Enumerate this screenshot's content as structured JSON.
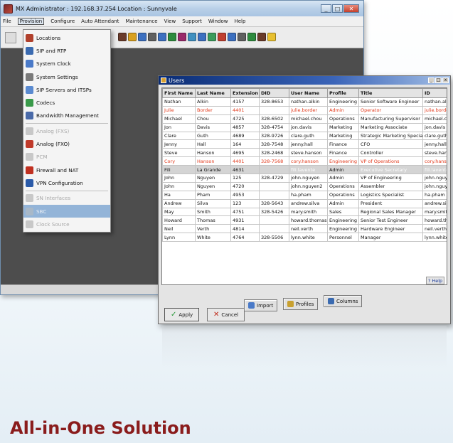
{
  "main_window": {
    "title": "MX Administrator : 192.168.37.254  Location : Sunnyvale",
    "controls": [
      "_",
      "□",
      "✕"
    ]
  },
  "menubar": [
    "File",
    "Provision",
    "Configure",
    "Auto Attendant",
    "Maintenance",
    "View",
    "Support",
    "Window",
    "Help"
  ],
  "provision_menu": [
    {
      "label": "Locations",
      "icon": "location-icon",
      "color": "#b0402c",
      "state": "normal"
    },
    {
      "label": "SIP and RTP",
      "icon": "sip-icon",
      "color": "#3a6ab0",
      "state": "normal"
    },
    {
      "label": "System Clock",
      "icon": "clock-icon",
      "color": "#4a7ac8",
      "state": "normal"
    },
    {
      "label": "System Settings",
      "icon": "wrench-icon",
      "color": "#7a7a7a",
      "state": "normal"
    },
    {
      "label": "SIP Servers and ITSPs",
      "icon": "server-icon",
      "color": "#5a8ad0",
      "state": "normal"
    },
    {
      "label": "Codecs",
      "icon": "codec-icon",
      "color": "#3a9a4a",
      "state": "normal"
    },
    {
      "label": "Bandwidth Management",
      "icon": "bandwidth-icon",
      "color": "#4a6aa8",
      "state": "normal"
    },
    {
      "label": "Analog (FXS)",
      "icon": "fxs-icon",
      "color": "#c8c8c8",
      "state": "disabled"
    },
    {
      "label": "Analog (FXO)",
      "icon": "fxo-icon",
      "color": "#c03a2a",
      "state": "normal"
    },
    {
      "label": "PCM",
      "icon": "pcm-icon",
      "color": "#c8c8c8",
      "state": "disabled"
    },
    {
      "label": "Firewall and NAT",
      "icon": "firewall-icon",
      "color": "#c03020",
      "state": "normal"
    },
    {
      "label": "VPN Configuration",
      "icon": "vpn-icon",
      "color": "#2a5aa8",
      "state": "normal"
    },
    {
      "label": "SN Interfaces",
      "icon": "sn-icon",
      "color": "#c8c8c8",
      "state": "disabled"
    },
    {
      "label": "SBC",
      "icon": "sbc-icon",
      "color": "#a8b8c8",
      "state": "selected"
    },
    {
      "label": "Clock Source",
      "icon": "clock-source-icon",
      "color": "#c8c8c8",
      "state": "disabled"
    }
  ],
  "users_window": {
    "title": "Users",
    "columns": [
      "First Name",
      "Last Name",
      "Extension",
      "DID",
      "User Name",
      "Profile",
      "Title",
      "ID"
    ],
    "rows": [
      {
        "cells": [
          "Nathan",
          "Alkin",
          "4157",
          "328-8653",
          "nathan.alkin",
          "Engineering",
          "Senior Software Engineer",
          "nathan.alkin"
        ],
        "style": "normal"
      },
      {
        "cells": [
          "Julie",
          "Border",
          "4401",
          "",
          "julie.border",
          "Admin",
          "Operator",
          "julie.border"
        ],
        "style": "red"
      },
      {
        "cells": [
          "Michael",
          "Chou",
          "4725",
          "328-6502",
          "michael.chou",
          "Operations",
          "Manufacturing Supervisor",
          "michael.chou"
        ],
        "style": "normal"
      },
      {
        "cells": [
          "Jon",
          "Davis",
          "4857",
          "328-4754",
          "jon.davis",
          "Marketing",
          "Marketing Associate",
          "jon.davis"
        ],
        "style": "normal"
      },
      {
        "cells": [
          "Clare",
          "Guth",
          "4689",
          "328-9726",
          "clare.guth",
          "Marketing",
          "Strategic Marketing Specialist",
          "clare.guth"
        ],
        "style": "normal"
      },
      {
        "cells": [
          "Jenny",
          "Hall",
          "164",
          "328-7548",
          "jenny.hall",
          "Finance",
          "CFO",
          "jenny.hall"
        ],
        "style": "normal"
      },
      {
        "cells": [
          "Steve",
          "Hanson",
          "4695",
          "328-2468",
          "steve.hanson",
          "Finance",
          "Controller",
          "steve.hanson"
        ],
        "style": "normal"
      },
      {
        "cells": [
          "Cory",
          "Hanson",
          "4401",
          "328-7568",
          "cory.hanson",
          "Engineering",
          "VP of Operations",
          "cory.hanson"
        ],
        "style": "red"
      },
      {
        "cells": [
          "Fili",
          "La Grande",
          "4631",
          "",
          "fili.lavente",
          "Admin",
          "Executive Secretary",
          "fili.lavente"
        ],
        "style": "group"
      },
      {
        "cells": [
          "John",
          "Nguyen",
          "125",
          "328-4729",
          "john.nguyen",
          "Admin",
          "VP of Engineering",
          "john.nguyen"
        ],
        "style": "normal"
      },
      {
        "cells": [
          "John",
          "Nguyen",
          "4720",
          "",
          "john.nguyen2",
          "Operations",
          "Assembler",
          "john.nguyen2"
        ],
        "style": "normal"
      },
      {
        "cells": [
          "Ha",
          "Pham",
          "4953",
          "",
          "ha.pham",
          "Operations",
          "Logistics Specialist",
          "ha.pham"
        ],
        "style": "normal"
      },
      {
        "cells": [
          "Andrew",
          "Silva",
          "123",
          "328-5643",
          "andrew.silva",
          "Admin",
          "President",
          "andrew.silva"
        ],
        "style": "normal"
      },
      {
        "cells": [
          "May",
          "Smith",
          "4751",
          "328-5426",
          "mary.smith",
          "Sales",
          "Regional Sales Manager",
          "mary.smith"
        ],
        "style": "normal"
      },
      {
        "cells": [
          "Howard",
          "Thomas",
          "4931",
          "",
          "howard.thomas",
          "Engineering",
          "Senior Test Engineer",
          "howard.thomas"
        ],
        "style": "normal"
      },
      {
        "cells": [
          "Neil",
          "Verth",
          "4814",
          "",
          "neil.verth",
          "Engineering",
          "Hardware Engineer",
          "neil.verth"
        ],
        "style": "normal"
      },
      {
        "cells": [
          "Lynn",
          "White",
          "4764",
          "328-5506",
          "lynn.white",
          "Personnel",
          "Manager",
          "lynn.white"
        ],
        "style": "normal"
      }
    ],
    "buttons": {
      "apply": "Apply",
      "cancel": "Cancel",
      "import": "Import",
      "profiles": "Profiles",
      "columns": "Columns",
      "help": "? Help"
    }
  },
  "tagline": "All-in-One Solution"
}
